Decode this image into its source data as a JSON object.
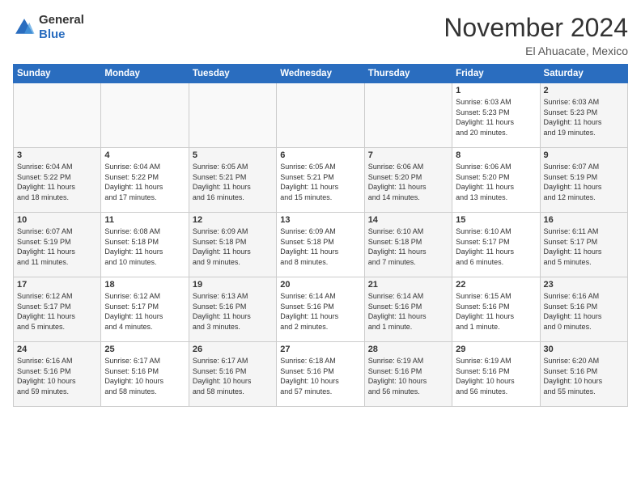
{
  "header": {
    "logo_line1": "General",
    "logo_line2": "Blue",
    "month": "November 2024",
    "location": "El Ahuacate, Mexico"
  },
  "days_of_week": [
    "Sunday",
    "Monday",
    "Tuesday",
    "Wednesday",
    "Thursday",
    "Friday",
    "Saturday"
  ],
  "weeks": [
    [
      {
        "day": "",
        "info": ""
      },
      {
        "day": "",
        "info": ""
      },
      {
        "day": "",
        "info": ""
      },
      {
        "day": "",
        "info": ""
      },
      {
        "day": "",
        "info": ""
      },
      {
        "day": "1",
        "info": "Sunrise: 6:03 AM\nSunset: 5:23 PM\nDaylight: 11 hours\nand 20 minutes."
      },
      {
        "day": "2",
        "info": "Sunrise: 6:03 AM\nSunset: 5:23 PM\nDaylight: 11 hours\nand 19 minutes."
      }
    ],
    [
      {
        "day": "3",
        "info": "Sunrise: 6:04 AM\nSunset: 5:22 PM\nDaylight: 11 hours\nand 18 minutes."
      },
      {
        "day": "4",
        "info": "Sunrise: 6:04 AM\nSunset: 5:22 PM\nDaylight: 11 hours\nand 17 minutes."
      },
      {
        "day": "5",
        "info": "Sunrise: 6:05 AM\nSunset: 5:21 PM\nDaylight: 11 hours\nand 16 minutes."
      },
      {
        "day": "6",
        "info": "Sunrise: 6:05 AM\nSunset: 5:21 PM\nDaylight: 11 hours\nand 15 minutes."
      },
      {
        "day": "7",
        "info": "Sunrise: 6:06 AM\nSunset: 5:20 PM\nDaylight: 11 hours\nand 14 minutes."
      },
      {
        "day": "8",
        "info": "Sunrise: 6:06 AM\nSunset: 5:20 PM\nDaylight: 11 hours\nand 13 minutes."
      },
      {
        "day": "9",
        "info": "Sunrise: 6:07 AM\nSunset: 5:19 PM\nDaylight: 11 hours\nand 12 minutes."
      }
    ],
    [
      {
        "day": "10",
        "info": "Sunrise: 6:07 AM\nSunset: 5:19 PM\nDaylight: 11 hours\nand 11 minutes."
      },
      {
        "day": "11",
        "info": "Sunrise: 6:08 AM\nSunset: 5:18 PM\nDaylight: 11 hours\nand 10 minutes."
      },
      {
        "day": "12",
        "info": "Sunrise: 6:09 AM\nSunset: 5:18 PM\nDaylight: 11 hours\nand 9 minutes."
      },
      {
        "day": "13",
        "info": "Sunrise: 6:09 AM\nSunset: 5:18 PM\nDaylight: 11 hours\nand 8 minutes."
      },
      {
        "day": "14",
        "info": "Sunrise: 6:10 AM\nSunset: 5:18 PM\nDaylight: 11 hours\nand 7 minutes."
      },
      {
        "day": "15",
        "info": "Sunrise: 6:10 AM\nSunset: 5:17 PM\nDaylight: 11 hours\nand 6 minutes."
      },
      {
        "day": "16",
        "info": "Sunrise: 6:11 AM\nSunset: 5:17 PM\nDaylight: 11 hours\nand 5 minutes."
      }
    ],
    [
      {
        "day": "17",
        "info": "Sunrise: 6:12 AM\nSunset: 5:17 PM\nDaylight: 11 hours\nand 5 minutes."
      },
      {
        "day": "18",
        "info": "Sunrise: 6:12 AM\nSunset: 5:17 PM\nDaylight: 11 hours\nand 4 minutes."
      },
      {
        "day": "19",
        "info": "Sunrise: 6:13 AM\nSunset: 5:16 PM\nDaylight: 11 hours\nand 3 minutes."
      },
      {
        "day": "20",
        "info": "Sunrise: 6:14 AM\nSunset: 5:16 PM\nDaylight: 11 hours\nand 2 minutes."
      },
      {
        "day": "21",
        "info": "Sunrise: 6:14 AM\nSunset: 5:16 PM\nDaylight: 11 hours\nand 1 minute."
      },
      {
        "day": "22",
        "info": "Sunrise: 6:15 AM\nSunset: 5:16 PM\nDaylight: 11 hours\nand 1 minute."
      },
      {
        "day": "23",
        "info": "Sunrise: 6:16 AM\nSunset: 5:16 PM\nDaylight: 11 hours\nand 0 minutes."
      }
    ],
    [
      {
        "day": "24",
        "info": "Sunrise: 6:16 AM\nSunset: 5:16 PM\nDaylight: 10 hours\nand 59 minutes."
      },
      {
        "day": "25",
        "info": "Sunrise: 6:17 AM\nSunset: 5:16 PM\nDaylight: 10 hours\nand 58 minutes."
      },
      {
        "day": "26",
        "info": "Sunrise: 6:17 AM\nSunset: 5:16 PM\nDaylight: 10 hours\nand 58 minutes."
      },
      {
        "day": "27",
        "info": "Sunrise: 6:18 AM\nSunset: 5:16 PM\nDaylight: 10 hours\nand 57 minutes."
      },
      {
        "day": "28",
        "info": "Sunrise: 6:19 AM\nSunset: 5:16 PM\nDaylight: 10 hours\nand 56 minutes."
      },
      {
        "day": "29",
        "info": "Sunrise: 6:19 AM\nSunset: 5:16 PM\nDaylight: 10 hours\nand 56 minutes."
      },
      {
        "day": "30",
        "info": "Sunrise: 6:20 AM\nSunset: 5:16 PM\nDaylight: 10 hours\nand 55 minutes."
      }
    ]
  ]
}
